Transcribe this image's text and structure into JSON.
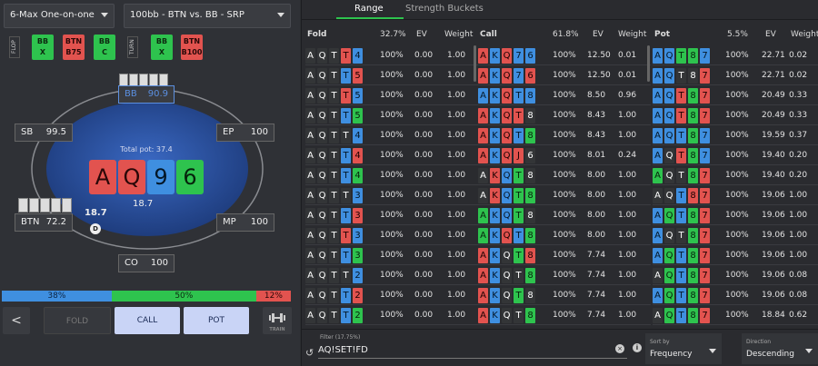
{
  "header": {
    "game_select": "6-Max One-on-one",
    "spot_select": "100bb - BTN vs. BB - SRP"
  },
  "streets": [
    {
      "label": "FLOP",
      "actions": [
        {
          "label": "BB\nX",
          "color": "g"
        },
        {
          "label": "BTN\nB75",
          "color": "r"
        },
        {
          "label": "BB\nC",
          "color": "g"
        }
      ]
    },
    {
      "label": "TURN",
      "actions": [
        {
          "label": "BB\nX",
          "color": "g"
        },
        {
          "label": "BTN\nB100",
          "color": "r"
        }
      ]
    }
  ],
  "table": {
    "bb_seat": {
      "name": "BB",
      "stack": "90.9"
    },
    "sb_seat": {
      "name": "SB",
      "stack": "99.5"
    },
    "ep_seat": {
      "name": "EP",
      "stack": "100"
    },
    "btn_seat": {
      "name": "BTN",
      "stack": "72.2"
    },
    "mp_seat": {
      "name": "MP",
      "stack": "100"
    },
    "co_seat": {
      "name": "CO",
      "stack": "100"
    },
    "total_pot": "Total pot: 37.4",
    "pot_amount": "18.7",
    "btn_bet": "18.7",
    "dealer_icon": "D",
    "board": [
      {
        "rank": "A",
        "suit": "r"
      },
      {
        "rank": "Q",
        "suit": "r"
      },
      {
        "rank": "9",
        "suit": "b"
      },
      {
        "rank": "6",
        "suit": "g"
      }
    ]
  },
  "strategy_bar": {
    "fold": "38%",
    "call": "50%",
    "pot": "12%",
    "fold_pct": 38,
    "call_pct": 50,
    "pot_pct": 12
  },
  "buttons": {
    "back": "<",
    "fold": "FOLD",
    "call": "CALL",
    "pot": "POT",
    "train": "TRAIN"
  },
  "tabs": {
    "range": "Range",
    "strength": "Strength Buckets"
  },
  "columns": [
    {
      "title": "Fold",
      "freq": "32.7%",
      "ev": "EV",
      "weight": "Weight"
    },
    {
      "title": "Call",
      "freq": "61.8%",
      "ev": "EV",
      "weight": "Weight"
    },
    {
      "title": "Pot",
      "freq": "5.5%",
      "ev": "EV",
      "weight": "Weight"
    }
  ],
  "fold_rows": [
    {
      "cards": [
        [
          "A",
          "x"
        ],
        [
          "Q",
          "x"
        ],
        [
          "T",
          "x"
        ],
        [
          "T",
          "r"
        ],
        [
          "4",
          "b"
        ]
      ],
      "pct": "100%",
      "ev": "0.00",
      "w": "1.00"
    },
    {
      "cards": [
        [
          "A",
          "x"
        ],
        [
          "Q",
          "x"
        ],
        [
          "T",
          "x"
        ],
        [
          "T",
          "b"
        ],
        [
          "5",
          "r"
        ]
      ],
      "pct": "100%",
      "ev": "0.00",
      "w": "1.00"
    },
    {
      "cards": [
        [
          "A",
          "x"
        ],
        [
          "Q",
          "x"
        ],
        [
          "T",
          "x"
        ],
        [
          "T",
          "r"
        ],
        [
          "5",
          "b"
        ]
      ],
      "pct": "100%",
      "ev": "0.00",
      "w": "1.00"
    },
    {
      "cards": [
        [
          "A",
          "x"
        ],
        [
          "Q",
          "x"
        ],
        [
          "T",
          "x"
        ],
        [
          "T",
          "b"
        ],
        [
          "5",
          "g"
        ]
      ],
      "pct": "100%",
      "ev": "0.00",
      "w": "1.00"
    },
    {
      "cards": [
        [
          "A",
          "x"
        ],
        [
          "Q",
          "x"
        ],
        [
          "T",
          "x"
        ],
        [
          "T",
          "x"
        ],
        [
          "4",
          "b"
        ]
      ],
      "pct": "100%",
      "ev": "0.00",
      "w": "1.00"
    },
    {
      "cards": [
        [
          "A",
          "x"
        ],
        [
          "Q",
          "x"
        ],
        [
          "T",
          "x"
        ],
        [
          "T",
          "b"
        ],
        [
          "4",
          "r"
        ]
      ],
      "pct": "100%",
      "ev": "0.00",
      "w": "1.00"
    },
    {
      "cards": [
        [
          "A",
          "x"
        ],
        [
          "Q",
          "x"
        ],
        [
          "T",
          "x"
        ],
        [
          "T",
          "b"
        ],
        [
          "4",
          "g"
        ]
      ],
      "pct": "100%",
      "ev": "0.00",
      "w": "1.00"
    },
    {
      "cards": [
        [
          "A",
          "x"
        ],
        [
          "Q",
          "x"
        ],
        [
          "T",
          "x"
        ],
        [
          "T",
          "x"
        ],
        [
          "3",
          "b"
        ]
      ],
      "pct": "100%",
      "ev": "0.00",
      "w": "1.00"
    },
    {
      "cards": [
        [
          "A",
          "x"
        ],
        [
          "Q",
          "x"
        ],
        [
          "T",
          "x"
        ],
        [
          "T",
          "b"
        ],
        [
          "3",
          "r"
        ]
      ],
      "pct": "100%",
      "ev": "0.00",
      "w": "1.00"
    },
    {
      "cards": [
        [
          "A",
          "x"
        ],
        [
          "Q",
          "x"
        ],
        [
          "T",
          "x"
        ],
        [
          "T",
          "r"
        ],
        [
          "3",
          "b"
        ]
      ],
      "pct": "100%",
      "ev": "0.00",
      "w": "1.00"
    },
    {
      "cards": [
        [
          "A",
          "x"
        ],
        [
          "Q",
          "x"
        ],
        [
          "T",
          "x"
        ],
        [
          "T",
          "b"
        ],
        [
          "3",
          "g"
        ]
      ],
      "pct": "100%",
      "ev": "0.00",
      "w": "1.00"
    },
    {
      "cards": [
        [
          "A",
          "x"
        ],
        [
          "Q",
          "x"
        ],
        [
          "T",
          "x"
        ],
        [
          "T",
          "x"
        ],
        [
          "2",
          "b"
        ]
      ],
      "pct": "100%",
      "ev": "0.00",
      "w": "1.00"
    },
    {
      "cards": [
        [
          "A",
          "x"
        ],
        [
          "Q",
          "x"
        ],
        [
          "T",
          "x"
        ],
        [
          "T",
          "b"
        ],
        [
          "2",
          "r"
        ]
      ],
      "pct": "100%",
      "ev": "0.00",
      "w": "1.00"
    },
    {
      "cards": [
        [
          "A",
          "x"
        ],
        [
          "Q",
          "x"
        ],
        [
          "T",
          "x"
        ],
        [
          "T",
          "b"
        ],
        [
          "2",
          "g"
        ]
      ],
      "pct": "100%",
      "ev": "0.00",
      "w": "1.00"
    }
  ],
  "call_rows": [
    {
      "cards": [
        [
          "A",
          "r"
        ],
        [
          "K",
          "b"
        ],
        [
          "Q",
          "r"
        ],
        [
          "7",
          "b"
        ],
        [
          "6",
          "b"
        ]
      ],
      "pct": "100%",
      "ev": "12.50",
      "w": "0.01"
    },
    {
      "cards": [
        [
          "A",
          "r"
        ],
        [
          "K",
          "b"
        ],
        [
          "Q",
          "r"
        ],
        [
          "7",
          "b"
        ],
        [
          "6",
          "r"
        ]
      ],
      "pct": "100%",
      "ev": "12.50",
      "w": "0.01"
    },
    {
      "cards": [
        [
          "A",
          "b"
        ],
        [
          "K",
          "b"
        ],
        [
          "Q",
          "r"
        ],
        [
          "T",
          "b"
        ],
        [
          "8",
          "b"
        ]
      ],
      "pct": "100%",
      "ev": "8.50",
      "w": "0.96"
    },
    {
      "cards": [
        [
          "A",
          "r"
        ],
        [
          "K",
          "b"
        ],
        [
          "Q",
          "r"
        ],
        [
          "T",
          "r"
        ],
        [
          "8",
          "x"
        ]
      ],
      "pct": "100%",
      "ev": "8.43",
      "w": "1.00"
    },
    {
      "cards": [
        [
          "A",
          "r"
        ],
        [
          "K",
          "b"
        ],
        [
          "Q",
          "r"
        ],
        [
          "T",
          "b"
        ],
        [
          "8",
          "g"
        ]
      ],
      "pct": "100%",
      "ev": "8.43",
      "w": "1.00"
    },
    {
      "cards": [
        [
          "A",
          "r"
        ],
        [
          "K",
          "b"
        ],
        [
          "Q",
          "r"
        ],
        [
          "J",
          "r"
        ],
        [
          "6",
          "x"
        ]
      ],
      "pct": "100%",
      "ev": "8.01",
      "w": "0.24"
    },
    {
      "cards": [
        [
          "A",
          "x"
        ],
        [
          "K",
          "r"
        ],
        [
          "Q",
          "b"
        ],
        [
          "T",
          "g"
        ],
        [
          "8",
          "x"
        ]
      ],
      "pct": "100%",
      "ev": "8.00",
      "w": "1.00"
    },
    {
      "cards": [
        [
          "A",
          "x"
        ],
        [
          "K",
          "r"
        ],
        [
          "Q",
          "b"
        ],
        [
          "T",
          "g"
        ],
        [
          "8",
          "g"
        ]
      ],
      "pct": "100%",
      "ev": "8.00",
      "w": "1.00"
    },
    {
      "cards": [
        [
          "A",
          "g"
        ],
        [
          "K",
          "b"
        ],
        [
          "Q",
          "b"
        ],
        [
          "T",
          "g"
        ],
        [
          "8",
          "x"
        ]
      ],
      "pct": "100%",
      "ev": "8.00",
      "w": "1.00"
    },
    {
      "cards": [
        [
          "A",
          "g"
        ],
        [
          "K",
          "b"
        ],
        [
          "Q",
          "r"
        ],
        [
          "T",
          "b"
        ],
        [
          "8",
          "g"
        ]
      ],
      "pct": "100%",
      "ev": "8.00",
      "w": "1.00"
    },
    {
      "cards": [
        [
          "A",
          "r"
        ],
        [
          "K",
          "b"
        ],
        [
          "Q",
          "x"
        ],
        [
          "T",
          "g"
        ],
        [
          "8",
          "r"
        ]
      ],
      "pct": "100%",
      "ev": "7.74",
      "w": "1.00"
    },
    {
      "cards": [
        [
          "A",
          "r"
        ],
        [
          "K",
          "b"
        ],
        [
          "Q",
          "x"
        ],
        [
          "T",
          "x"
        ],
        [
          "8",
          "g"
        ]
      ],
      "pct": "100%",
      "ev": "7.74",
      "w": "1.00"
    },
    {
      "cards": [
        [
          "A",
          "r"
        ],
        [
          "K",
          "b"
        ],
        [
          "Q",
          "x"
        ],
        [
          "T",
          "g"
        ],
        [
          "8",
          "x"
        ]
      ],
      "pct": "100%",
      "ev": "7.74",
      "w": "1.00"
    },
    {
      "cards": [
        [
          "A",
          "r"
        ],
        [
          "K",
          "b"
        ],
        [
          "Q",
          "x"
        ],
        [
          "T",
          "x"
        ],
        [
          "8",
          "g"
        ]
      ],
      "pct": "100%",
      "ev": "7.74",
      "w": "1.00"
    }
  ],
  "pot_rows": [
    {
      "cards": [
        [
          "A",
          "b"
        ],
        [
          "Q",
          "b"
        ],
        [
          "T",
          "g"
        ],
        [
          "8",
          "g"
        ],
        [
          "7",
          "b"
        ]
      ],
      "pct": "100%",
      "ev": "22.71",
      "w": "0.02"
    },
    {
      "cards": [
        [
          "A",
          "b"
        ],
        [
          "Q",
          "b"
        ],
        [
          "T",
          "x"
        ],
        [
          "8",
          "x"
        ],
        [
          "7",
          "r"
        ]
      ],
      "pct": "100%",
      "ev": "22.71",
      "w": "0.02"
    },
    {
      "cards": [
        [
          "A",
          "b"
        ],
        [
          "Q",
          "b"
        ],
        [
          "T",
          "r"
        ],
        [
          "8",
          "g"
        ],
        [
          "7",
          "r"
        ]
      ],
      "pct": "100%",
      "ev": "20.49",
      "w": "0.33"
    },
    {
      "cards": [
        [
          "A",
          "b"
        ],
        [
          "Q",
          "b"
        ],
        [
          "T",
          "r"
        ],
        [
          "8",
          "g"
        ],
        [
          "7",
          "r"
        ]
      ],
      "pct": "100%",
      "ev": "20.49",
      "w": "0.33"
    },
    {
      "cards": [
        [
          "A",
          "b"
        ],
        [
          "Q",
          "b"
        ],
        [
          "T",
          "b"
        ],
        [
          "8",
          "g"
        ],
        [
          "7",
          "b"
        ]
      ],
      "pct": "100%",
      "ev": "19.59",
      "w": "0.37"
    },
    {
      "cards": [
        [
          "A",
          "b"
        ],
        [
          "Q",
          "x"
        ],
        [
          "T",
          "r"
        ],
        [
          "8",
          "g"
        ],
        [
          "7",
          "b"
        ]
      ],
      "pct": "100%",
      "ev": "19.40",
      "w": "0.20"
    },
    {
      "cards": [
        [
          "A",
          "g"
        ],
        [
          "Q",
          "x"
        ],
        [
          "T",
          "x"
        ],
        [
          "8",
          "g"
        ],
        [
          "7",
          "r"
        ]
      ],
      "pct": "100%",
      "ev": "19.40",
      "w": "0.20"
    },
    {
      "cards": [
        [
          "A",
          "x"
        ],
        [
          "Q",
          "x"
        ],
        [
          "T",
          "b"
        ],
        [
          "8",
          "r"
        ],
        [
          "7",
          "r"
        ]
      ],
      "pct": "100%",
      "ev": "19.06",
      "w": "1.00"
    },
    {
      "cards": [
        [
          "A",
          "b"
        ],
        [
          "Q",
          "g"
        ],
        [
          "T",
          "b"
        ],
        [
          "8",
          "g"
        ],
        [
          "7",
          "r"
        ]
      ],
      "pct": "100%",
      "ev": "19.06",
      "w": "1.00"
    },
    {
      "cards": [
        [
          "A",
          "b"
        ],
        [
          "Q",
          "x"
        ],
        [
          "T",
          "x"
        ],
        [
          "8",
          "g"
        ],
        [
          "7",
          "r"
        ]
      ],
      "pct": "100%",
      "ev": "19.06",
      "w": "1.00"
    },
    {
      "cards": [
        [
          "A",
          "b"
        ],
        [
          "Q",
          "g"
        ],
        [
          "T",
          "b"
        ],
        [
          "8",
          "g"
        ],
        [
          "7",
          "r"
        ]
      ],
      "pct": "100%",
      "ev": "19.06",
      "w": "1.00"
    },
    {
      "cards": [
        [
          "A",
          "x"
        ],
        [
          "Q",
          "g"
        ],
        [
          "T",
          "b"
        ],
        [
          "8",
          "g"
        ],
        [
          "7",
          "r"
        ]
      ],
      "pct": "100%",
      "ev": "19.06",
      "w": "0.08"
    },
    {
      "cards": [
        [
          "A",
          "b"
        ],
        [
          "Q",
          "g"
        ],
        [
          "T",
          "b"
        ],
        [
          "8",
          "g"
        ],
        [
          "7",
          "r"
        ]
      ],
      "pct": "100%",
      "ev": "19.06",
      "w": "0.08"
    },
    {
      "cards": [
        [
          "A",
          "x"
        ],
        [
          "Q",
          "g"
        ],
        [
          "T",
          "b"
        ],
        [
          "8",
          "g"
        ],
        [
          "7",
          "r"
        ]
      ],
      "pct": "100%",
      "ev": "18.84",
      "w": "0.62"
    }
  ],
  "footer": {
    "filter_label": "Filter (17.75%)",
    "filter_value": "AQ!SET!FD",
    "sort_label": "Sort by",
    "sort_value": "Frequency",
    "direction_label": "Direction",
    "direction_value": "Descending"
  },
  "colors": {
    "red": "#e2534f",
    "blue": "#3f8fe0",
    "green": "#2ec34e",
    "dark": "#333537"
  }
}
